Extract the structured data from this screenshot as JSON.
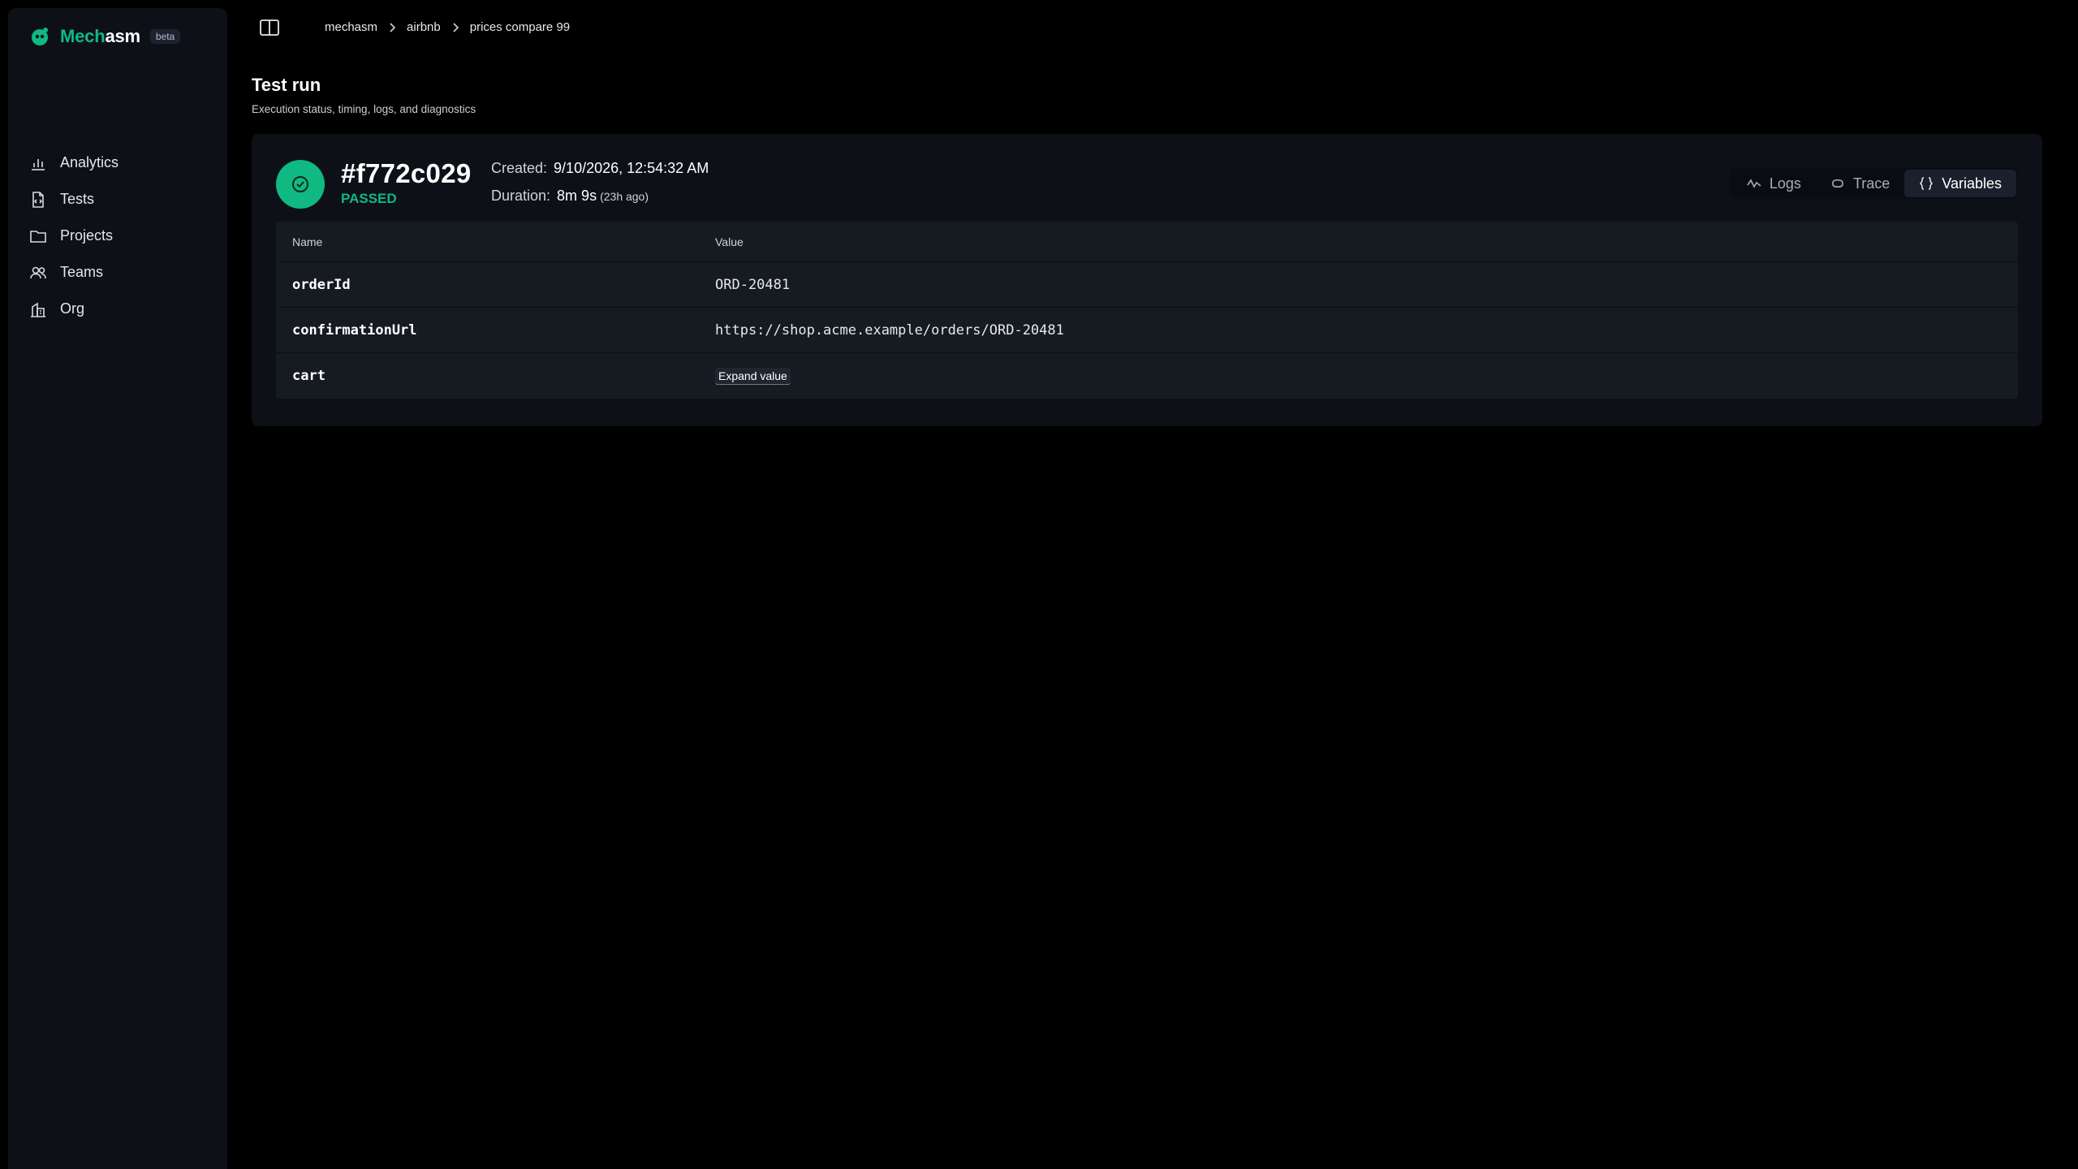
{
  "app": {
    "brand_part1": "Mech",
    "brand_part2": "asm",
    "badge": "beta",
    "accent_color": "#10b981"
  },
  "sidebar": {
    "items": [
      {
        "label": "Analytics",
        "icon": "bar-chart-icon"
      },
      {
        "label": "Tests",
        "icon": "test-file-icon"
      },
      {
        "label": "Projects",
        "icon": "folder-icon"
      },
      {
        "label": "Teams",
        "icon": "users-icon"
      },
      {
        "label": "Org",
        "icon": "building-icon"
      }
    ]
  },
  "breadcrumb": {
    "items": [
      "mechasm",
      "airbnb",
      "prices compare 99"
    ]
  },
  "page": {
    "title": "Test run",
    "subtitle": "Execution status, timing, logs, and diagnostics"
  },
  "run": {
    "id": "#f772c029",
    "status": "PASSED",
    "created_label": "Created:",
    "created_value": "9/10/2026, 12:54:32 AM",
    "duration_label": "Duration:",
    "duration_value": "8m 9s",
    "duration_ago": "(23h ago)"
  },
  "tabs": [
    {
      "label": "Logs",
      "icon": "activity-icon",
      "active": false
    },
    {
      "label": "Trace",
      "icon": "layers-icon",
      "active": false
    },
    {
      "label": "Variables",
      "icon": "braces-icon",
      "active": true
    }
  ],
  "variables": {
    "columns": [
      "Name",
      "Value"
    ],
    "rows": [
      {
        "name": "orderId",
        "value": "ORD-20481"
      },
      {
        "name": "confirmationUrl",
        "value": "https://shop.acme.example/orders/ORD-20481"
      },
      {
        "name": "cart",
        "value": "",
        "action": "Expand value"
      }
    ]
  }
}
